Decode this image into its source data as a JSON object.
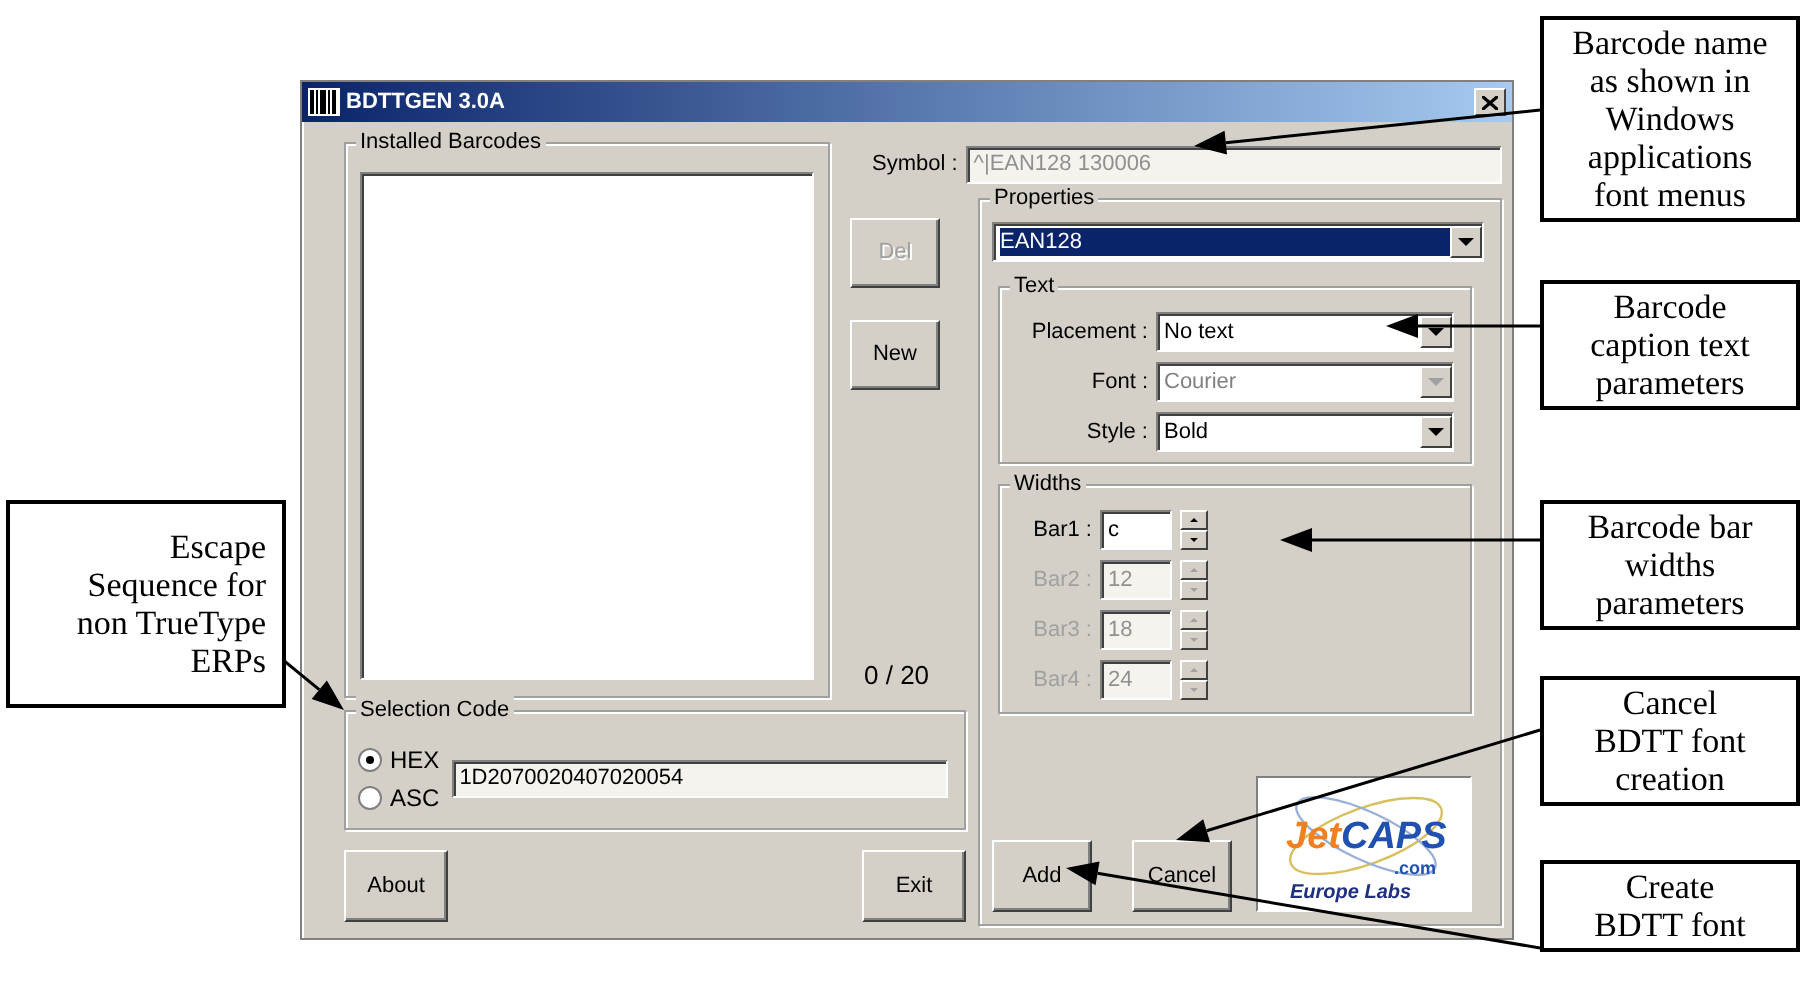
{
  "window": {
    "title": "BDTTGEN 3.0A"
  },
  "installed_barcodes": {
    "label": "Installed Barcodes",
    "count": "0 / 20"
  },
  "symbol": {
    "label": "Symbol :",
    "value": "^|EAN128 130006",
    "disabled": true
  },
  "side_buttons": [
    {
      "label": "Del",
      "disabled": true
    },
    {
      "label": "New",
      "disabled": false
    }
  ],
  "properties": {
    "label": "Properties",
    "barcode": {
      "value": "EAN128",
      "selected": true
    },
    "text_group": {
      "label": "Text",
      "fields": [
        {
          "label": "Placement :",
          "value": "No text",
          "disabled": false
        },
        {
          "label": "Font :",
          "value": "Courier",
          "disabled": true
        },
        {
          "label": "Style :",
          "value": "Bold",
          "disabled": false
        }
      ]
    },
    "widths_group": {
      "label": "Widths",
      "bars": [
        {
          "label": "Bar1 :",
          "value": "c",
          "disabled": false
        },
        {
          "label": "Bar2 :",
          "value": "12",
          "disabled": true
        },
        {
          "label": "Bar3 :",
          "value": "18",
          "disabled": true
        },
        {
          "label": "Bar4 :",
          "value": "24",
          "disabled": true
        }
      ]
    }
  },
  "selection_code": {
    "label": "Selection Code",
    "options": [
      {
        "label": "HEX",
        "selected": true
      },
      {
        "label": "ASC",
        "selected": false
      }
    ],
    "value": "1D2070020407020054"
  },
  "bottom_buttons": [
    {
      "label": "About"
    },
    {
      "label": "Exit"
    }
  ],
  "action_buttons": [
    {
      "label": "Add"
    },
    {
      "label": "Cancel"
    }
  ],
  "logo": {
    "name_parts": [
      "Jet",
      "CAPS"
    ],
    "domain": ".com",
    "tagline": "Europe Labs"
  },
  "callouts": [
    {
      "lines": [
        "Barcode name",
        "as shown in",
        "Windows",
        "applications",
        "font menus"
      ]
    },
    {
      "lines": [
        "Barcode",
        "caption text",
        "parameters"
      ]
    },
    {
      "lines": [
        "Barcode bar",
        "widths",
        "parameters"
      ]
    },
    {
      "lines": [
        "Escape",
        "Sequence for",
        "non TrueType",
        "ERPs"
      ]
    },
    {
      "lines": [
        "Cancel",
        "BDTT font",
        "creation"
      ]
    },
    {
      "lines": [
        "Create",
        "BDTT font"
      ]
    }
  ]
}
